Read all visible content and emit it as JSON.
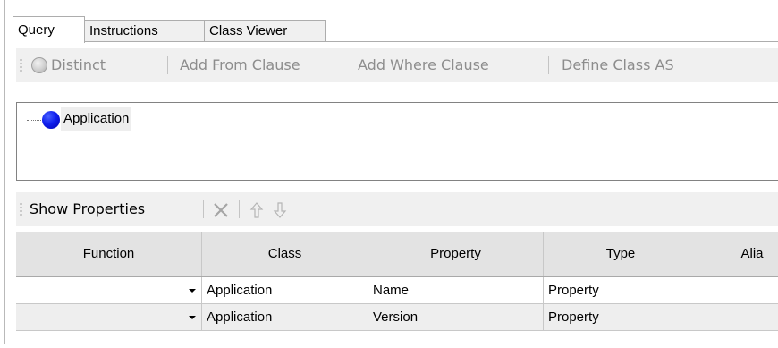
{
  "tabs": [
    {
      "label": "Query",
      "active": true
    },
    {
      "label": "Instructions",
      "active": false
    },
    {
      "label": "Class Viewer",
      "active": false
    }
  ],
  "query_toolbar": {
    "distinct_label": "Distinct",
    "add_from_label": "Add From Clause",
    "add_where_label": "Add Where Clause",
    "define_class_label": "Define Class AS"
  },
  "tree": {
    "node_label": "Application",
    "node_icon": "blue-circle-icon",
    "node_color": "#0a14e8"
  },
  "props_toolbar": {
    "show_properties_label": "Show Properties",
    "icons": [
      "delete-x-icon",
      "move-up-arrow-icon",
      "move-down-arrow-icon"
    ]
  },
  "grid": {
    "columns": [
      "Function",
      "Class",
      "Property",
      "Type",
      "Alia"
    ],
    "rows": [
      {
        "function": "",
        "class": "Application",
        "property": "Name",
        "type": "Property",
        "alias": ""
      },
      {
        "function": "",
        "class": "Application",
        "property": "Version",
        "type": "Property",
        "alias": ""
      }
    ]
  },
  "colors": {
    "toolbar_bg": "#f0f0f0",
    "header_bg": "#e3e3e3",
    "alt_row_bg": "#eeeeee",
    "disabled_text": "#8d8d8d"
  }
}
